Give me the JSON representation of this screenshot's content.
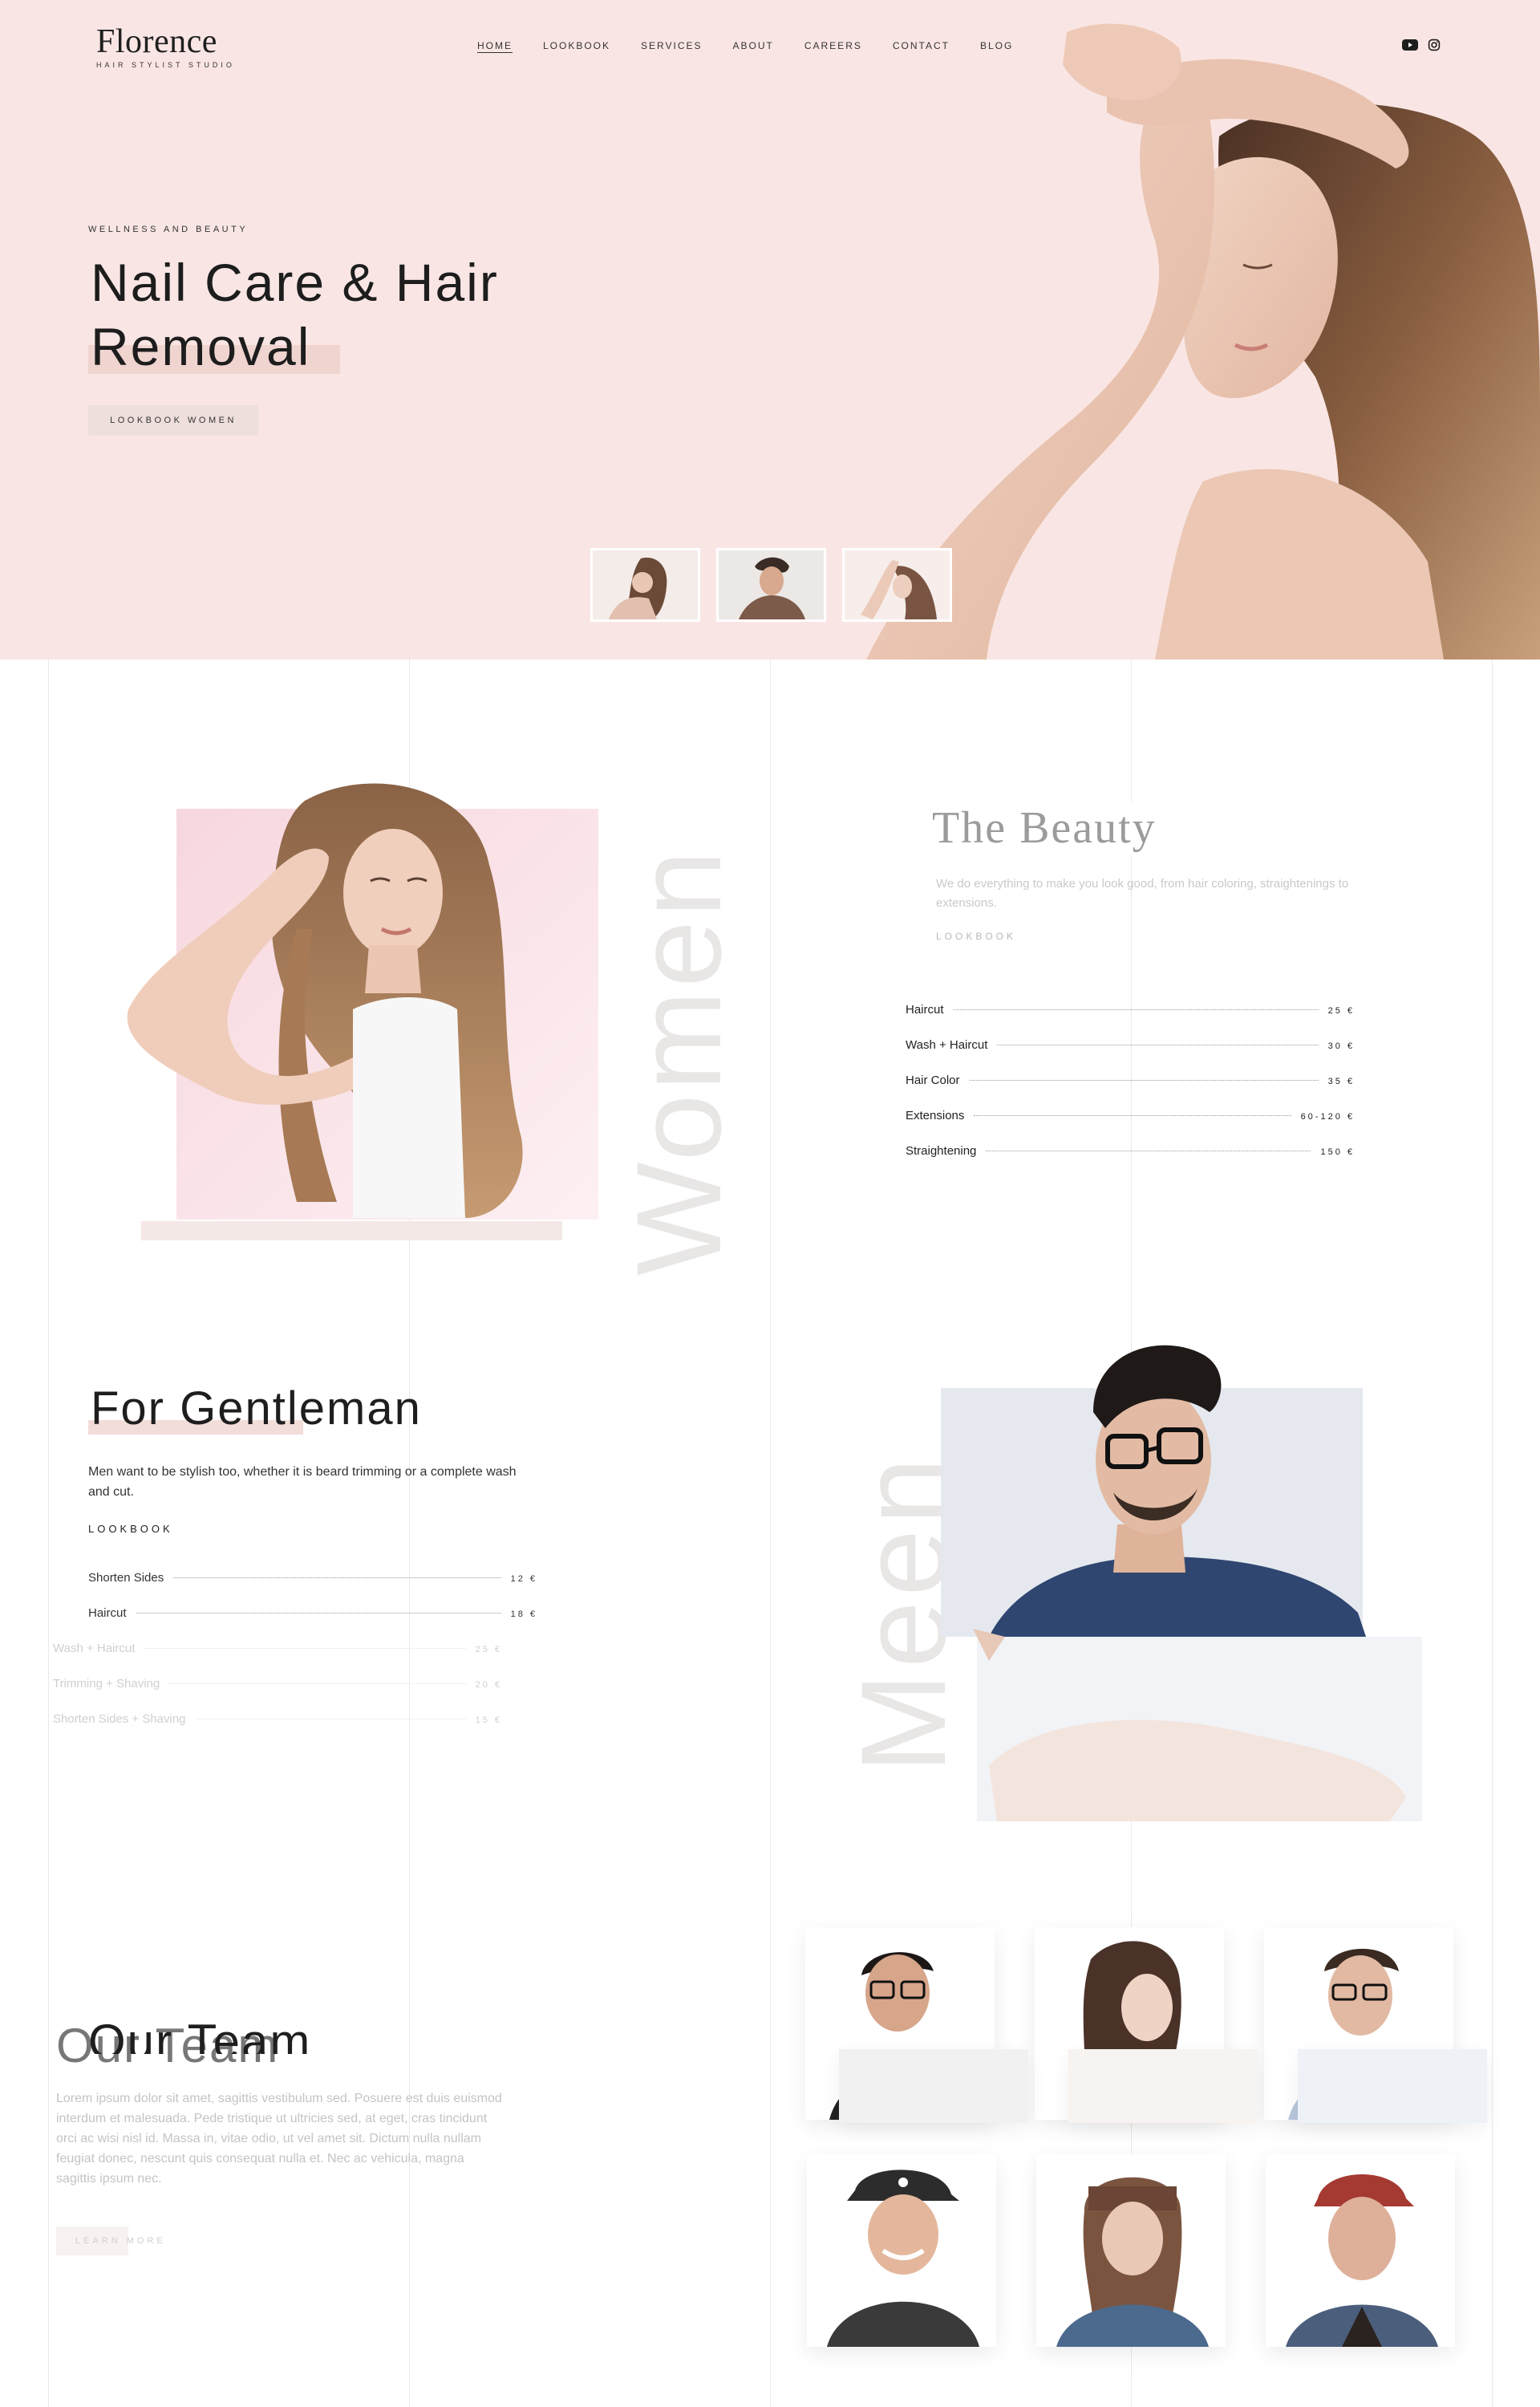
{
  "brand": {
    "name": "Florence",
    "tagline": "HAIR STYLIST STUDIO"
  },
  "nav": {
    "items": [
      {
        "label": "HOME",
        "active": true
      },
      {
        "label": "LOOKBOOK",
        "active": false
      },
      {
        "label": "SERVICES",
        "active": false
      },
      {
        "label": "ABOUT",
        "active": false
      },
      {
        "label": "CAREERS",
        "active": false
      },
      {
        "label": "CONTACT",
        "active": false
      },
      {
        "label": "BLOG",
        "active": false
      }
    ],
    "social_icons": [
      "youtube-icon",
      "instagram-icon"
    ]
  },
  "hero": {
    "eyebrow": "WELLNESS AND BEAUTY",
    "title_line1": "Nail Care & Hair",
    "title_line2": "Removal",
    "button": "LOOKBOOK WOMEN"
  },
  "women": {
    "word": "Women",
    "title": "The Beauty",
    "description": "We do everything to make you look good, from hair coloring, straightenings to extensions.",
    "link": "LOOKBOOK",
    "prices": [
      {
        "name": "Haircut",
        "price": "25 €"
      },
      {
        "name": "Wash + Haircut",
        "price": "30 €"
      },
      {
        "name": "Hair Color",
        "price": "35 €"
      },
      {
        "name": "Extensions",
        "price": "60-120 €"
      },
      {
        "name": "Straightening",
        "price": "150 €"
      }
    ]
  },
  "gentleman": {
    "title": "For Gentleman",
    "description": "Men want to be stylish too, whether it is beard trimming or a complete wash and cut.",
    "link": "LOOKBOOK",
    "word": "Meen",
    "prices": [
      {
        "name": "Shorten Sides",
        "price": "12 €"
      },
      {
        "name": "Haircut",
        "price": "18 €"
      },
      {
        "name": "Wash + Haircut",
        "price": "25 €"
      },
      {
        "name": "Trimming + Shaving",
        "price": "20 €"
      },
      {
        "name": "Shorten Sides + Shaving",
        "price": "15 €"
      }
    ]
  },
  "team": {
    "title": "Our Team",
    "description": "Lorem ipsum dolor sit amet, sagittis vestibulum sed. Posuere est duis euismod interdum et malesuada. Pede tristique ut ultricies sed, at eget, cras tincidunt orci ac wisi nisl id. Massa in, vitae odio, ut vel amet sit. Dictum nulla nullam feugiat donec, nescunt quis consequat nulla et. Nec ac vehicula, magna sagittis ipsum nec.",
    "button": "LEARN MORE"
  },
  "colors": {
    "hero_bg": "#f9e6e4",
    "accent_mark": "#f0d4cf",
    "text": "#1d1d1d",
    "ghost": "#e9e6e6"
  }
}
